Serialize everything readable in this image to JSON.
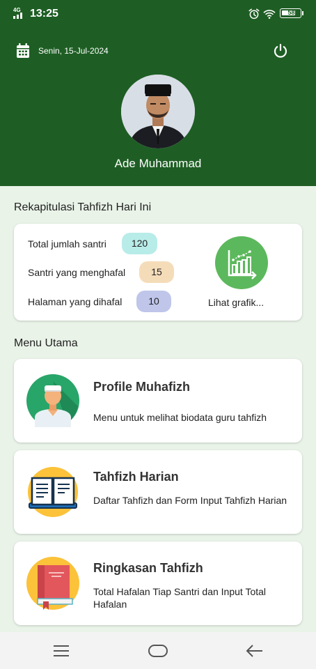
{
  "status_bar": {
    "network": "4G",
    "time": "13:25",
    "battery": "58",
    "icons": [
      "signal-icon",
      "alarm-icon",
      "wifi-icon",
      "battery-icon"
    ]
  },
  "header": {
    "date": "Senin, 15-Jul-2024",
    "user_name": "Ade Muhammad",
    "icons": [
      "calendar-icon",
      "power-icon",
      "avatar"
    ]
  },
  "summary": {
    "title": "Rekapitulasi Tahfizh Hari Ini",
    "stats": [
      {
        "label": "Total jumlah santri",
        "value": "120",
        "color": "#b8ece8"
      },
      {
        "label": "Santri yang menghafal",
        "value": "15",
        "color": "#f5dcb9"
      },
      {
        "label": "Halaman yang dihafal",
        "value": "10",
        "color": "#bfc6ea"
      }
    ],
    "chart_link": "Lihat grafik..."
  },
  "menu": {
    "title": "Menu Utama",
    "items": [
      {
        "title": "Profile Muhafizh",
        "desc": "Menu untuk melihat biodata guru tahfizh",
        "icon": "teacher-icon"
      },
      {
        "title": "Tahfizh Harian",
        "desc": "Daftar Tahfizh dan Form Input Tahfizh Harian",
        "icon": "open-book-icon"
      },
      {
        "title": "Ringkasan Tahfizh",
        "desc": "Total Hafalan Tiap Santri dan Input Total Hafalan",
        "icon": "closed-book-icon"
      }
    ]
  },
  "navbar": {
    "icons": [
      "menu-icon",
      "home-icon",
      "back-icon"
    ]
  },
  "colors": {
    "primary": "#1e5e24",
    "background": "#e9f3e8",
    "chart_button": "#5cb85c"
  }
}
